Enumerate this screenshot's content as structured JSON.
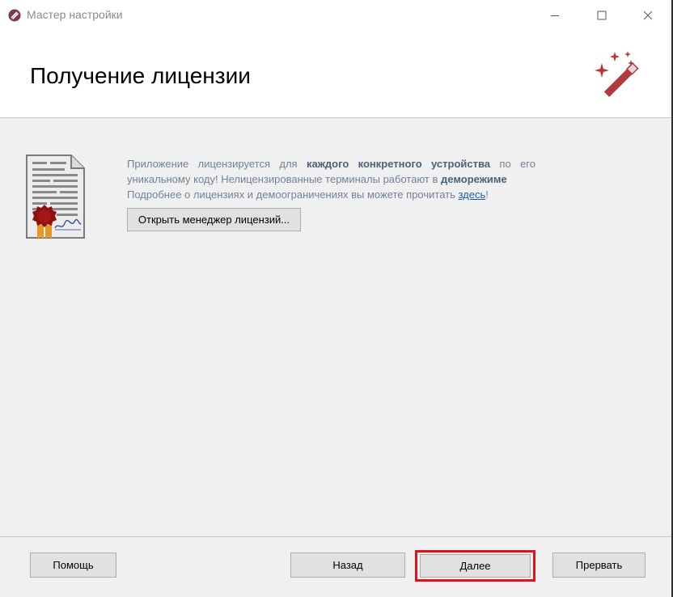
{
  "window": {
    "title": "Мастер настройки",
    "app_icon": "app-logo-icon",
    "controls": [
      "minimize-icon",
      "maximize-icon",
      "close-icon"
    ]
  },
  "header": {
    "title": "Получение лицензии",
    "icon": "magic-wand-icon"
  },
  "content": {
    "icon": "license-certificate-icon",
    "info": {
      "p1_part1": "Приложение лицензируется для ",
      "p1_bold": "каждого конкретного устройства",
      "p1_part2": " по его уникальному коду! Нелицензированные терминалы работают в ",
      "p1_bold2": "деморежиме",
      "p2_text": "Подробнее о лицензиях и демоограничениях вы можете прочитать ",
      "p2_link": "здесь",
      "p2_end": "!"
    },
    "license_manager_button": "Открыть менеджер лицензий..."
  },
  "footer": {
    "help": "Помощь",
    "back": "Назад",
    "next": "Далее",
    "abort": "Прервать"
  },
  "colors": {
    "accent_red": "#e3101d",
    "icon_red": "#b23a3a",
    "info_text": "#6f8296",
    "link": "#1a5fb4"
  }
}
